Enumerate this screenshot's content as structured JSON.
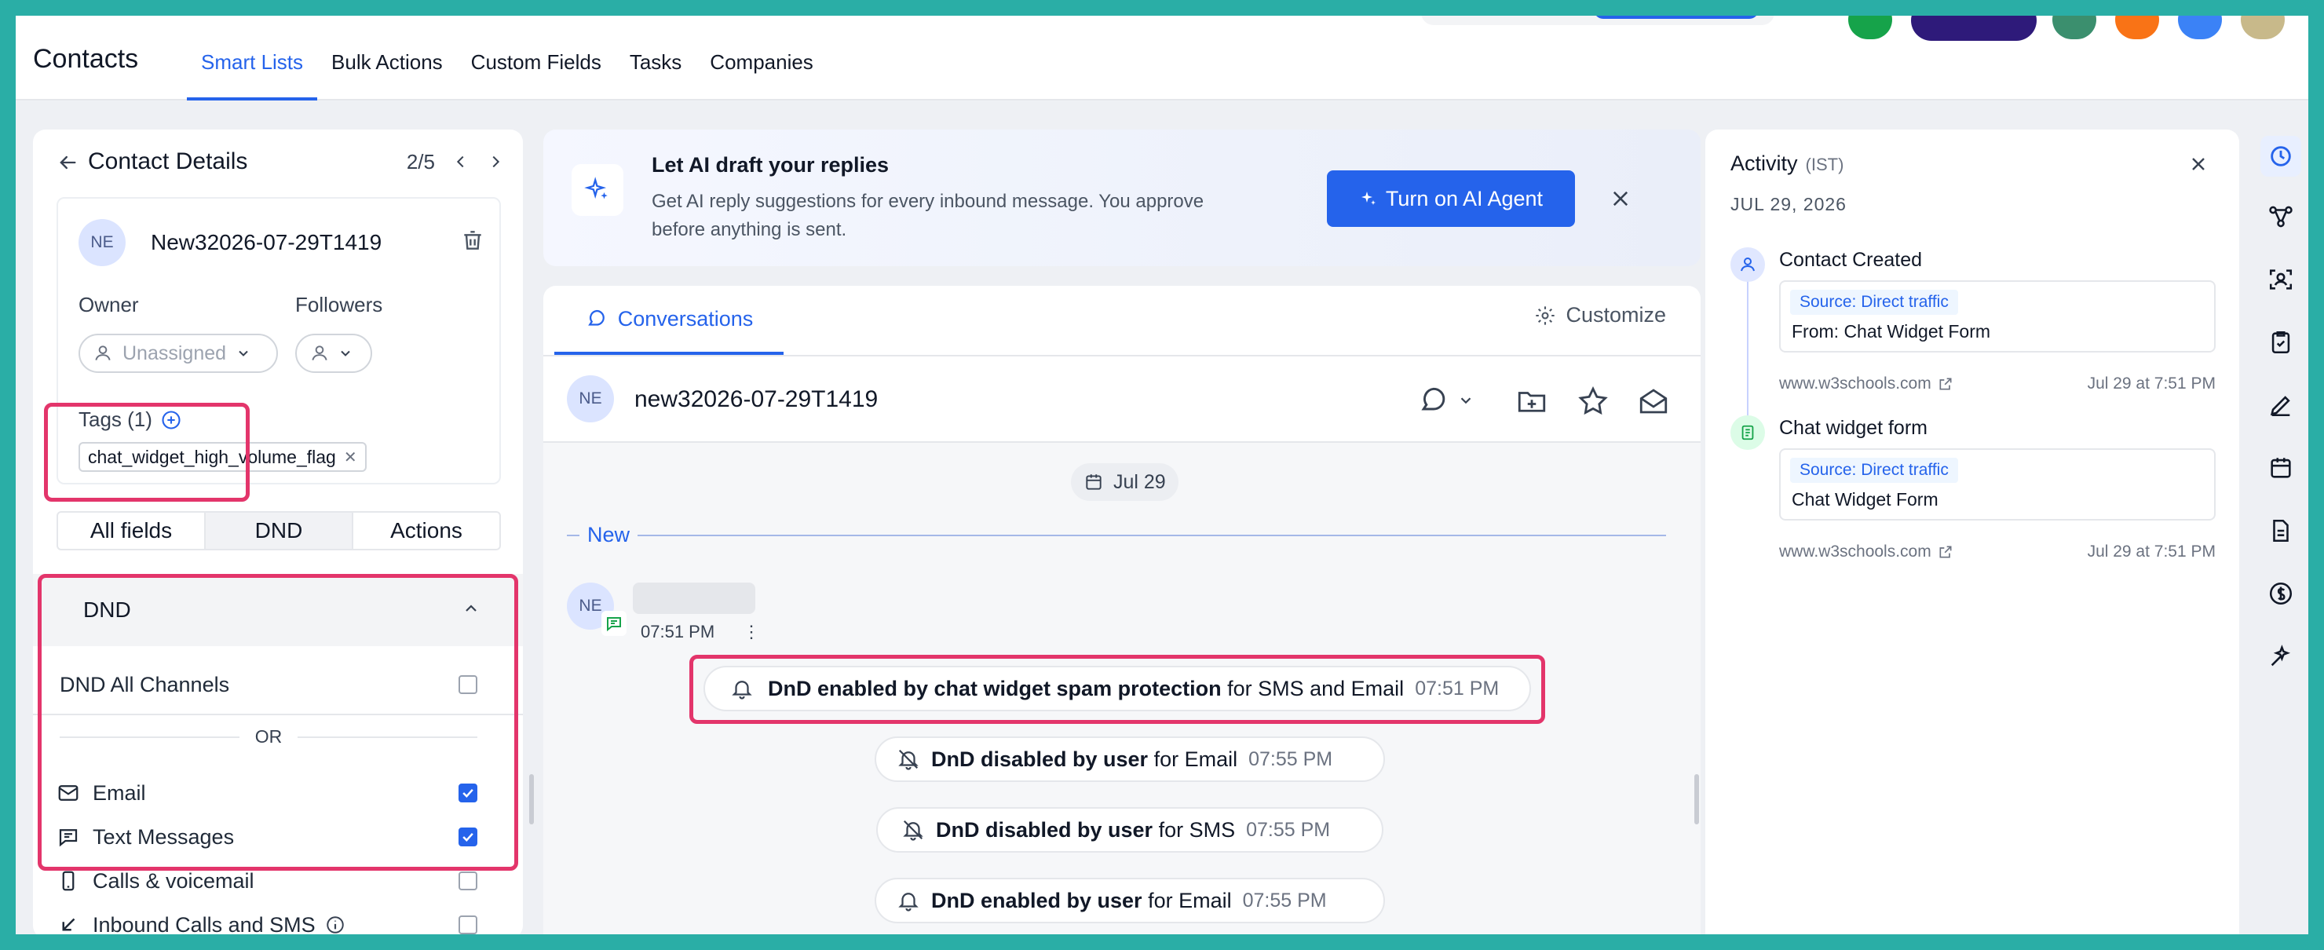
{
  "topbar": {
    "brand": "Contacts",
    "tabs": [
      {
        "label": "Smart Lists",
        "active": true
      },
      {
        "label": "Bulk Actions"
      },
      {
        "label": "Custom Fields"
      },
      {
        "label": "Tasks"
      },
      {
        "label": "Companies"
      }
    ]
  },
  "contact_details": {
    "title": "Contact Details",
    "pager": "2/5",
    "initials": "NE",
    "name": "New32026-07-29T1419",
    "owner_label": "Owner",
    "owner_value": "Unassigned",
    "followers_label": "Followers",
    "tags_label": "Tags (1)",
    "tag": "chat_widget_high_volume_flag",
    "tabs": [
      "All fields",
      "DND",
      "Actions"
    ],
    "active_tab": "DND"
  },
  "dnd": {
    "header": "DND",
    "all_channels": "DND All Channels",
    "or": "OR",
    "channels": [
      {
        "label": "Email",
        "checked": true
      },
      {
        "label": "Text Messages",
        "checked": true
      },
      {
        "label": "Calls & voicemail",
        "checked": false
      },
      {
        "label": "Inbound Calls and SMS",
        "checked": false
      }
    ]
  },
  "ai_banner": {
    "title": "Let AI draft your replies",
    "body_line1": "Get AI reply suggestions for every inbound message. You approve",
    "body_line2": "before anything is sent.",
    "button": "Turn on AI Agent"
  },
  "conversation": {
    "tab": "Conversations",
    "customize": "Customize",
    "initials": "NE",
    "name": "new32026-07-29T1419",
    "date_chip": "Jul 29",
    "new_label": "New",
    "msg_time": "07:51 PM",
    "events": [
      {
        "bold": "DnD enabled by chat widget spam protection",
        "rest": "for SMS and Email",
        "time": "07:51 PM"
      },
      {
        "bold": "DnD disabled by user",
        "rest": "for Email",
        "time": "07:55 PM"
      },
      {
        "bold": "DnD disabled by user",
        "rest": "for SMS",
        "time": "07:55 PM"
      },
      {
        "bold": "DnD enabled by user",
        "rest": "for Email",
        "time": "07:55 PM"
      }
    ]
  },
  "activity": {
    "title": "Activity",
    "tz": "(IST)",
    "date": "JUL 29, 2026",
    "items": [
      {
        "title": "Contact Created",
        "source": "Source: Direct traffic",
        "detail": "From: Chat Widget Form",
        "site": "www.w3schools.com",
        "when": "Jul 29 at 7:51 PM"
      },
      {
        "title": "Chat widget form",
        "source": "Source: Direct traffic",
        "detail": "Chat Widget Form",
        "site": "www.w3schools.com",
        "when": "Jul 29 at 7:51 PM"
      }
    ]
  },
  "colors": {
    "accent": "#2563eb",
    "highlight": "#e3356b",
    "frame": "#2aaea6"
  }
}
